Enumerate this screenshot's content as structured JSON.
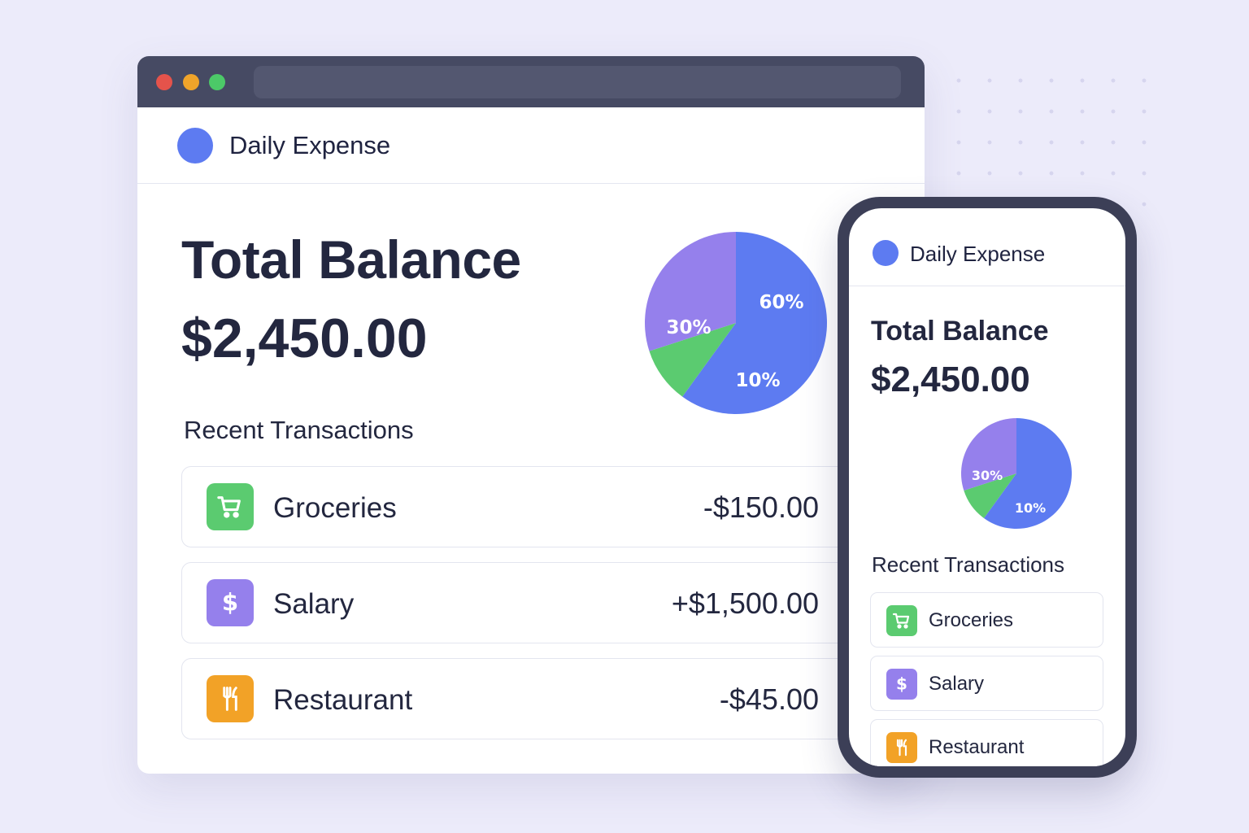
{
  "app": {
    "name": "Daily Expense"
  },
  "balance": {
    "label": "Total Balance",
    "amount": "$2,450.00"
  },
  "chart_data": {
    "type": "pie",
    "slices": [
      {
        "label": "60%",
        "value": 60,
        "color": "#5d7bf1"
      },
      {
        "label": "10%",
        "value": 10,
        "color": "#5bcb70"
      },
      {
        "label": "30%",
        "value": 30,
        "color": "#9580ec"
      }
    ]
  },
  "transactions": {
    "title": "Recent Transactions",
    "items": [
      {
        "name": "Groceries",
        "amount": "-$150.00",
        "icon": "cart-icon",
        "color": "#5bcb70"
      },
      {
        "name": "Salary",
        "amount": "+$1,500.00",
        "icon": "dollar-icon",
        "color": "#9580ec"
      },
      {
        "name": "Restaurant",
        "amount": "-$45.00",
        "icon": "utensils-icon",
        "color": "#f2a227"
      }
    ]
  },
  "mobile": {
    "app_name": "Daily Expense",
    "balance_label": "Total Balance",
    "balance_amount": "$2,450.00",
    "chart_labels": [
      "30%",
      "10%"
    ],
    "transactions_title": "Recent Transactions",
    "transactions": [
      "Groceries",
      "Salary",
      "Restaurant"
    ]
  }
}
